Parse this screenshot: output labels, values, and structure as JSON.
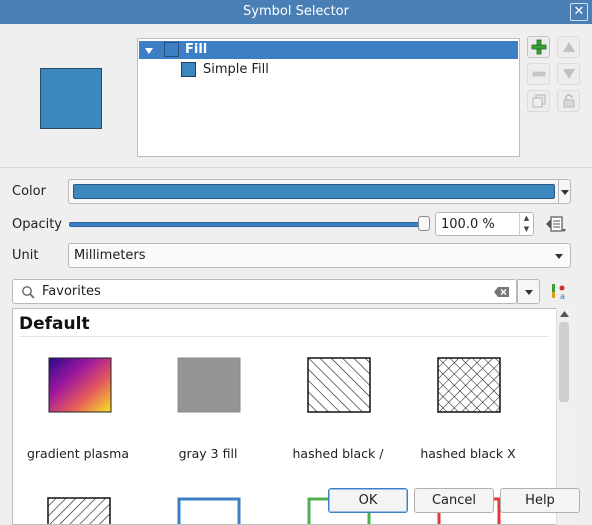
{
  "window": {
    "title": "Symbol Selector"
  },
  "symbol_tree": {
    "items": [
      {
        "label": "Fill",
        "selected": true
      },
      {
        "label": "Simple Fill",
        "selected": false
      }
    ]
  },
  "layer_toolbar": [
    "add-layer",
    "move-up",
    "remove-layer",
    "move-down",
    "duplicate-layer",
    "lock-layer"
  ],
  "form": {
    "color_label": "Color",
    "color_value": "#3c87bd",
    "opacity_label": "Opacity",
    "opacity_value": "100.0 %",
    "opacity_fraction": 1.0,
    "unit_label": "Unit",
    "unit_value": "Millimeters"
  },
  "library": {
    "search_value": "Favorites",
    "group_title": "Default",
    "items": [
      {
        "label": "gradient  plasma"
      },
      {
        "label": "gray 3 fill"
      },
      {
        "label": "hashed black /"
      },
      {
        "label": "hashed black X"
      }
    ]
  },
  "buttons": {
    "ok": "OK",
    "cancel": "Cancel",
    "help": "Help"
  },
  "colors": {
    "accent": "#3d7fc4",
    "symbol_fill": "#3c87bd",
    "titlebar": "#4a7fb5"
  }
}
